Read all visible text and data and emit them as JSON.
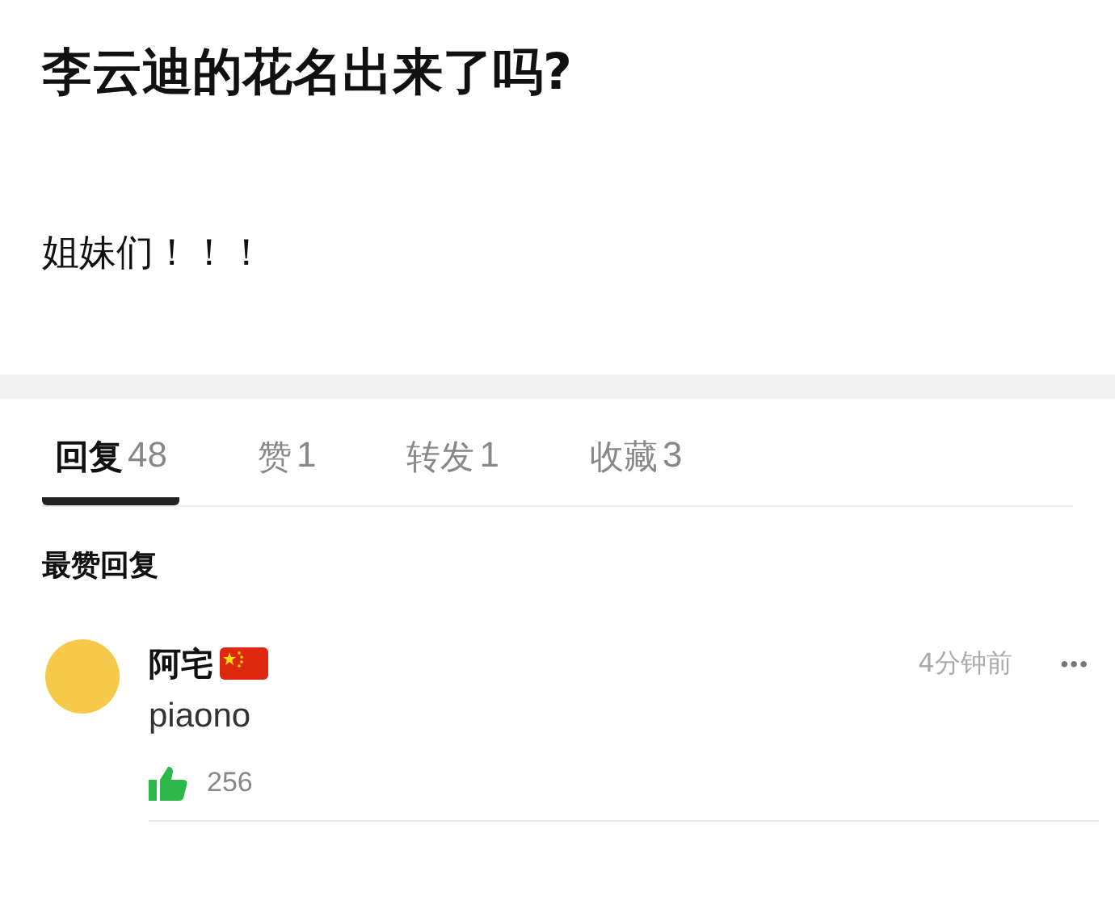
{
  "post": {
    "title": "李云迪的花名出来了吗?",
    "body": "姐妹们！！！"
  },
  "tabs": [
    {
      "label": "回复",
      "count": "48",
      "selected": true
    },
    {
      "label": "赞",
      "count": "1",
      "selected": false
    },
    {
      "label": "转发",
      "count": "1",
      "selected": false
    },
    {
      "label": "收藏",
      "count": "3",
      "selected": false
    }
  ],
  "section_title": "最赞回复",
  "comments": [
    {
      "author": "阿宅",
      "time": "4分钟前",
      "more": "•••",
      "text": "piaono",
      "likes": "256"
    }
  ]
}
